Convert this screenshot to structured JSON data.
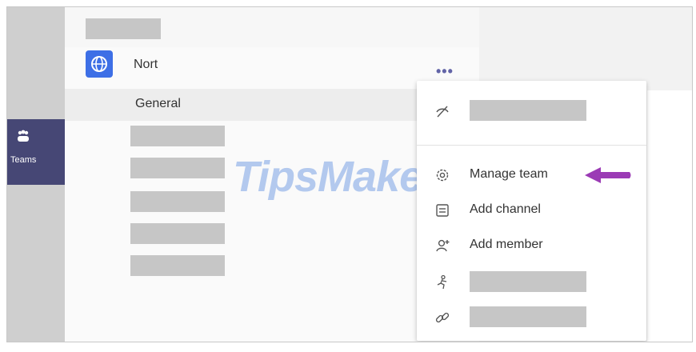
{
  "rail": {
    "teams_label": "Teams"
  },
  "team": {
    "name": "Nort",
    "more_label": "•••"
  },
  "channel": {
    "name": "General"
  },
  "watermark": {
    "text": "TipsMake"
  },
  "menu": {
    "items": [
      {
        "label": "Manage team",
        "icon": "gear-icon"
      },
      {
        "label": "Add channel",
        "icon": "channel-icon"
      },
      {
        "label": "Add member",
        "icon": "add-member-icon"
      }
    ]
  },
  "colors": {
    "rail": "#464775",
    "team_icon": "#3d6fe6",
    "accent": "#6264a7",
    "arrow": "#9b3bb5"
  }
}
